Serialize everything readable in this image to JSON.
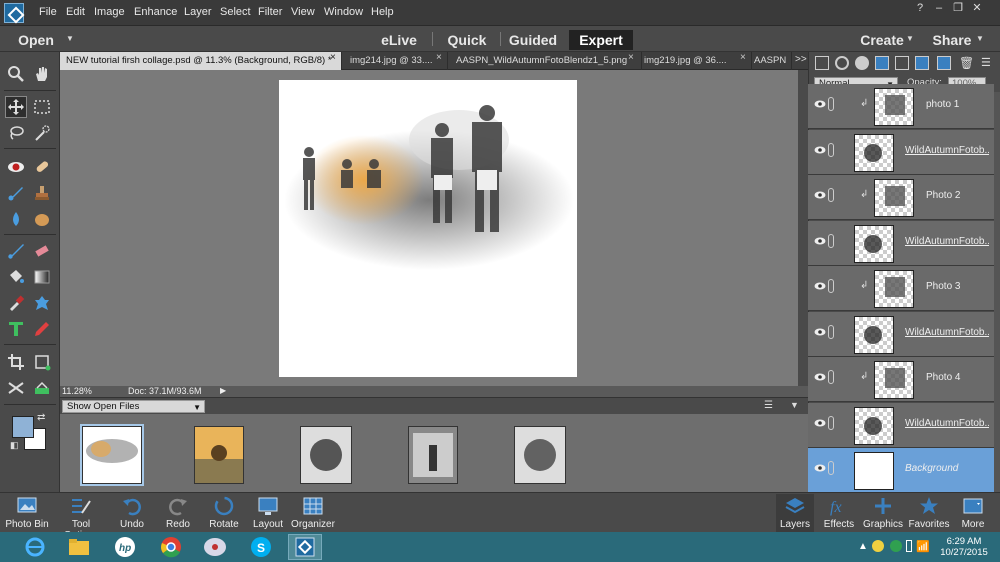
{
  "menubar": {
    "items": [
      "File",
      "Edit",
      "Image",
      "Enhance",
      "Layer",
      "Select",
      "Filter",
      "View",
      "Window",
      "Help"
    ],
    "window_controls": [
      "?",
      "–",
      "❐",
      "✕"
    ]
  },
  "modebar": {
    "open": "Open",
    "modes": [
      "eLive",
      "Quick",
      "Guided",
      "Expert"
    ],
    "active_mode": "Expert",
    "create": "Create",
    "share": "Share"
  },
  "tabs": [
    {
      "label": "NEW tutorial firsh collage.psd @ 11.3% (Background, RGB/8) *",
      "close": "×"
    },
    {
      "label": "img214.jpg @ 33....",
      "close": "×"
    },
    {
      "label": "AASPN_WildAutumnFotoBlendz1_5.png",
      "close": "×"
    },
    {
      "label": "img219.jpg @ 36....",
      "close": "×"
    },
    {
      "label": "AASPN",
      "close": ""
    }
  ],
  "tabs_overflow": ">>",
  "status": {
    "zoom": "11.28%",
    "doc": "Doc: 37.1M/93.6M"
  },
  "photobin": {
    "dropdown": "Show Open Files"
  },
  "layers_panel": {
    "blend_mode": "Normal",
    "opacity_label": "Opacity:",
    "opacity_value": "100%",
    "layers": [
      {
        "name": "photo 1",
        "clipped": true
      },
      {
        "name": "WildAutumnFotob...",
        "clipped": false
      },
      {
        "name": "Photo 2",
        "clipped": true
      },
      {
        "name": "WildAutumnFotob...",
        "clipped": false
      },
      {
        "name": "Photo 3",
        "clipped": true
      },
      {
        "name": "WildAutumnFotob...",
        "clipped": false
      },
      {
        "name": "Photo 4",
        "clipped": true
      },
      {
        "name": "WildAutumnFotob...",
        "clipped": false
      },
      {
        "name": "Background",
        "clipped": false,
        "selected": true
      }
    ]
  },
  "bottom_left": [
    {
      "label": "Photo Bin",
      "icon": "photo-bin-icon"
    },
    {
      "label": "Tool Options",
      "icon": "tool-options-icon"
    },
    {
      "label": "Undo",
      "icon": "undo-icon"
    },
    {
      "label": "Redo",
      "icon": "redo-icon"
    },
    {
      "label": "Rotate",
      "icon": "rotate-icon"
    },
    {
      "label": "Layout",
      "icon": "layout-icon"
    },
    {
      "label": "Organizer",
      "icon": "organizer-icon"
    }
  ],
  "bottom_right": [
    {
      "label": "Layers",
      "icon": "layers-icon"
    },
    {
      "label": "Effects",
      "icon": "fx-icon"
    },
    {
      "label": "Graphics",
      "icon": "plus-icon"
    },
    {
      "label": "Favorites",
      "icon": "star-icon"
    },
    {
      "label": "More",
      "icon": "more-icon"
    }
  ],
  "taskbar": {
    "time": "6:29 AM",
    "date": "10/27/2015"
  },
  "colors": {
    "accent_blue": "#6aa0d8",
    "foreground_swatch": "#8fb2d6",
    "background_swatch": "#ffffff",
    "orange_photo": "#f0a53c"
  }
}
